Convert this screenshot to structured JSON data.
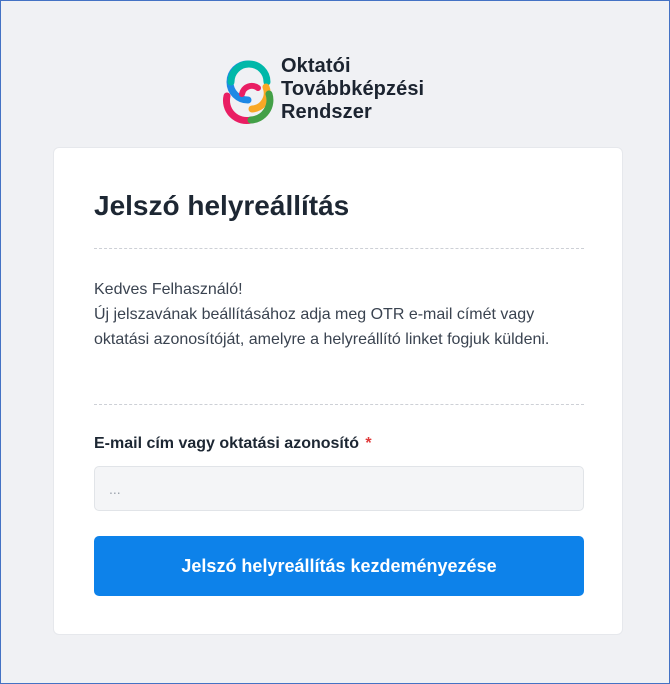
{
  "brand": {
    "name_lines": [
      "Oktatói",
      "Továbbképzési",
      "Rendszer"
    ],
    "colors": [
      "#1e88e5",
      "#00b8a9",
      "#f9a825",
      "#e91e63",
      "#43a047"
    ]
  },
  "card": {
    "title": "Jelszó helyreállítás",
    "intro_lines": [
      "Kedves Felhasználó!",
      "Új jelszavának beállításához adja meg OTR e-mail címét vagy oktatási azonosítóját, amelyre a helyreállító linket fogjuk küldeni."
    ],
    "field_label": "E-mail cím vagy oktatási azonosító",
    "required_marker": "*",
    "input": {
      "value": "",
      "placeholder": "..."
    },
    "submit_label": "Jelszó helyreállítás kezdeményezése"
  },
  "colors": {
    "accent": "#0d82ea",
    "required": "#e03a3a",
    "background": "#f0f1f4",
    "border": "#4472c4"
  }
}
